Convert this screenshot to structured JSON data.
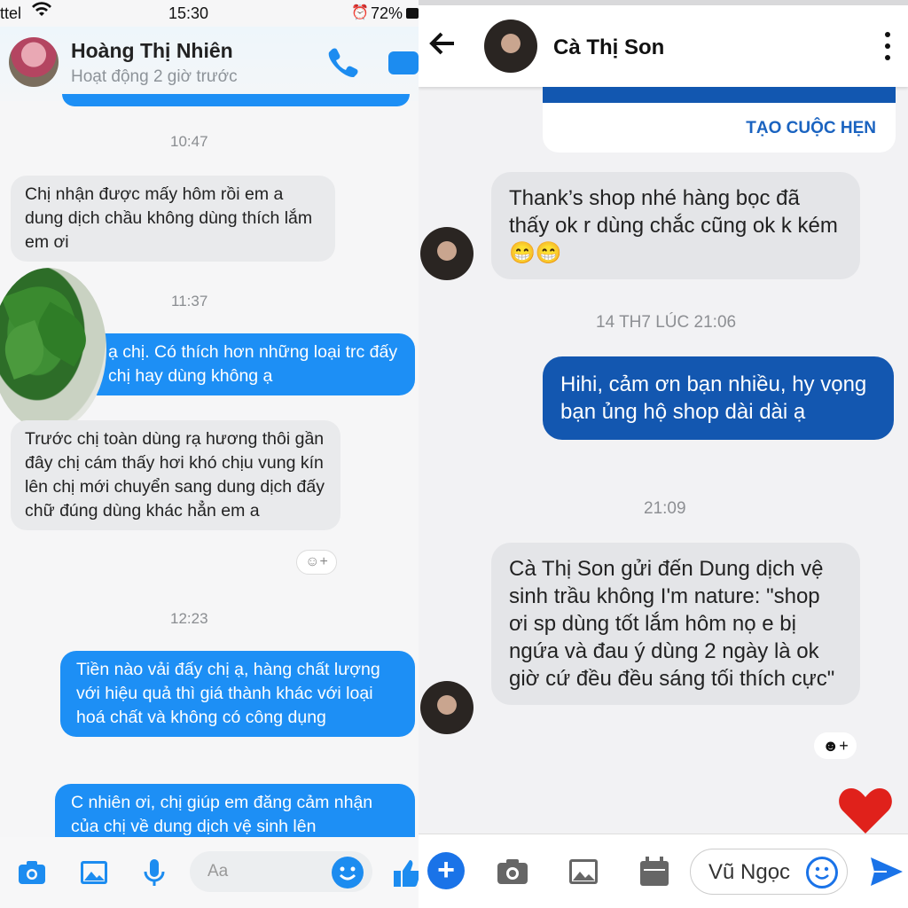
{
  "left": {
    "status": {
      "carrier": "ttel",
      "time": "15:30",
      "battery": "72%"
    },
    "header": {
      "name": "Hoàng Thị Nhiên",
      "status": "Hoạt động 2 giờ trước"
    },
    "messages": [
      {
        "ts": "10:47"
      },
      {
        "text": "Chị nhận được mấy hôm rồi em a dung dịch chầu không dùng thích lắm em ơi"
      },
      {
        "ts": "11:37"
      },
      {
        "text": "ạ chị. Có thích hơn những loại trc đấy chị hay dùng không ạ"
      },
      {
        "text": "Trước chị toàn dùng rạ hương thôi gần đây chị cám thấy hơi khó chịu vung kín lên chị mới chuyển sang dung dịch đấy chữ đúng dùng khác hẳn em a"
      },
      {
        "ts": "12:23"
      },
      {
        "text": "Tiền nào vải đấy chị ạ, hàng chất lượng với hiệu quả thì giá thành khác với loại hoá chất và không có công dụng"
      },
      {
        "text": "C nhiên ơi, chị giúp em đăng cảm nhận của chị về dung dịch vệ sinh lên"
      }
    ],
    "composer": {
      "placeholder": "Aa"
    }
  },
  "right": {
    "header": {
      "name": "Cà Thị Son"
    },
    "card": {
      "button": "TẠO CUỘC HẸN"
    },
    "messages": [
      {
        "text": "Thank’s shop nhé hàng bọc đã thấy ok r dùng chắc cũng ok k kém 😁😁"
      },
      {
        "ts": "14 TH7 LÚC 21:06"
      },
      {
        "text": "Hihi, cảm ơn bạn nhiều, hy vọng bạn ủng hộ shop dài dài ạ"
      },
      {
        "ts": "21:09"
      },
      {
        "text": "Cà Thị Son gửi đến Dung dịch vệ sinh trầu không I'm nature: \"shop ơi sp dùng tốt lắm hôm nọ e bị ngứa và đau ý  dùng 2 ngày là ok giờ cứ đều đều sáng tối thích cực\""
      }
    ],
    "composer": {
      "value": "Vũ Ngọc"
    }
  },
  "colors": {
    "messenger_blue": "#1d8ff5",
    "fb_blue": "#1357b0",
    "heart": "#e0211b"
  },
  "icons": [
    "wifi-icon",
    "alarm-icon",
    "battery-icon",
    "phone-icon",
    "video-icon",
    "camera-icon",
    "gallery-icon",
    "mic-icon",
    "emoji-icon",
    "like-icon",
    "back-icon",
    "more-icon",
    "plus-icon",
    "calendar-icon",
    "smile-icon",
    "send-icon",
    "heart-icon",
    "add-reaction-icon"
  ]
}
